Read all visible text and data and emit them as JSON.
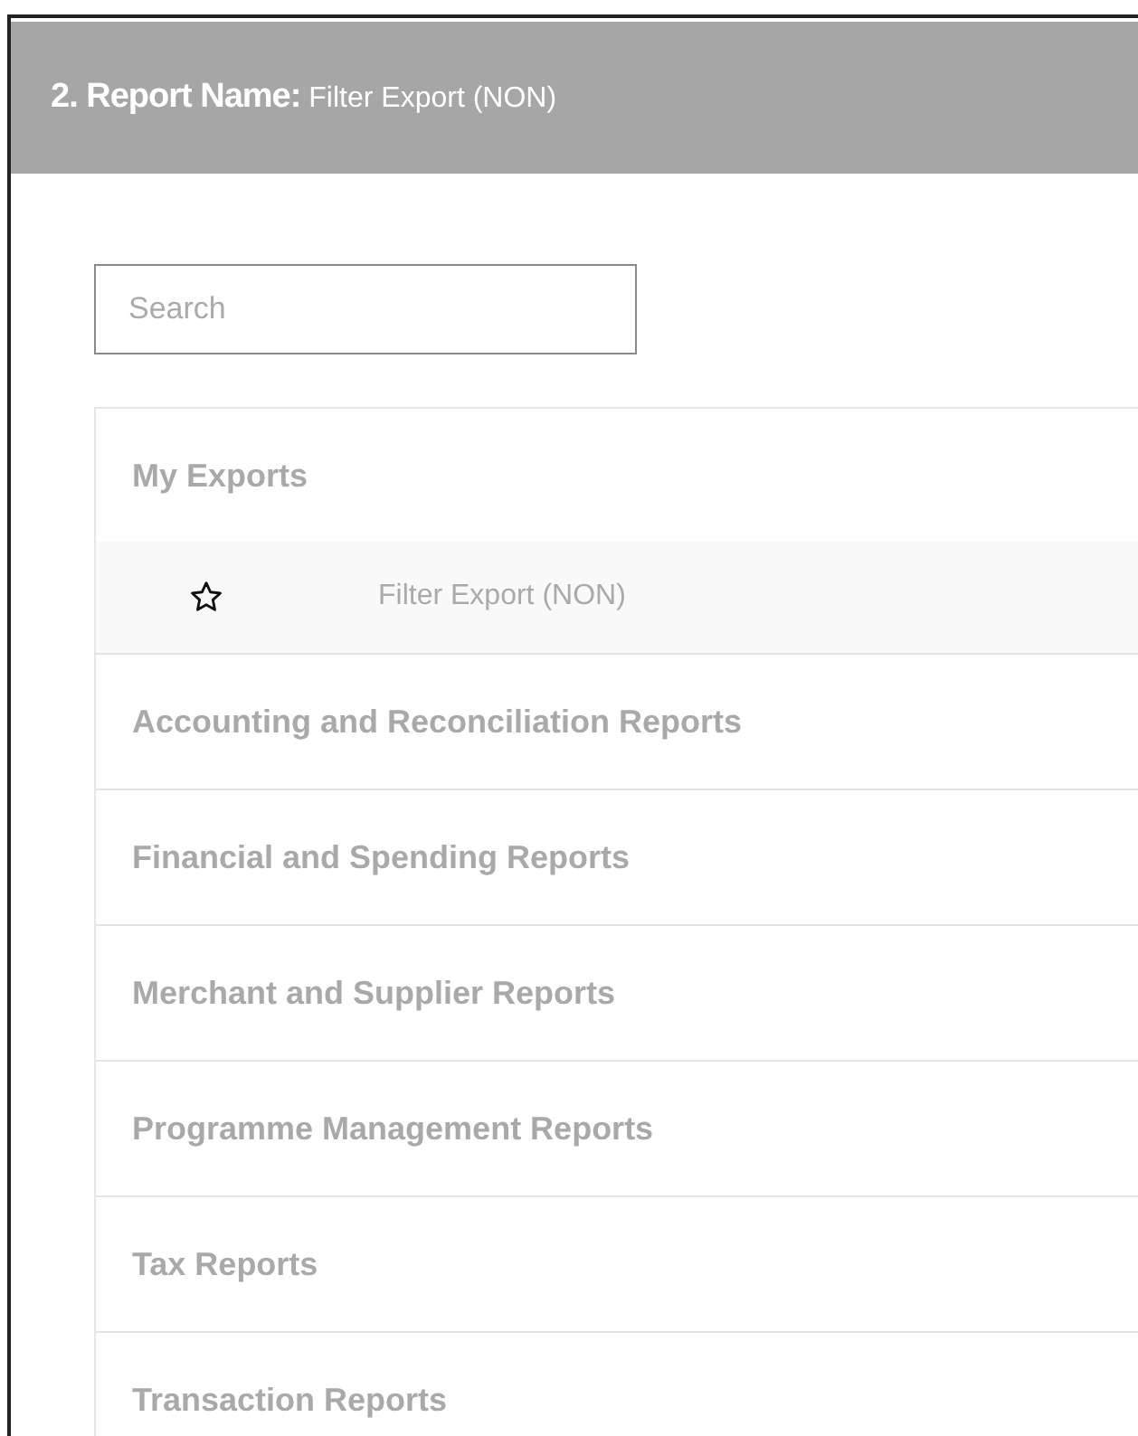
{
  "header": {
    "number": "2.",
    "label": "Report Name:",
    "value": "Filter Export (NON)"
  },
  "search": {
    "placeholder": "Search"
  },
  "sections": [
    {
      "title": "My Exports",
      "items": [
        {
          "label": "Filter Export (NON)",
          "starred": false
        }
      ]
    },
    {
      "title": "Accounting and Reconciliation Reports"
    },
    {
      "title": "Financial and Spending Reports"
    },
    {
      "title": "Merchant and Supplier Reports"
    },
    {
      "title": "Programme Management Reports"
    },
    {
      "title": "Tax Reports"
    },
    {
      "title": "Transaction Reports"
    }
  ]
}
